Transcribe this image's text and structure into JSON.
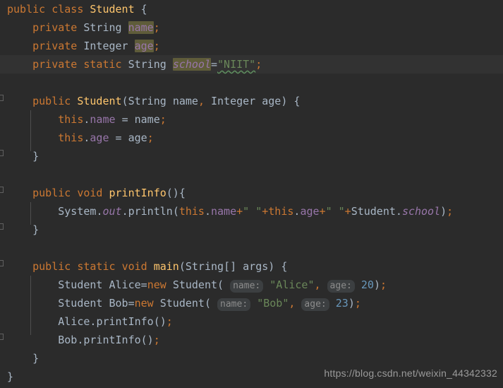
{
  "editor": {
    "language": "java",
    "theme": "darcula",
    "background_color": "#2b2b2b",
    "current_line_color": "#323232",
    "default_text_color": "#a9b7c6",
    "current_line_number": 4,
    "colors": {
      "keyword": "#cc7832",
      "string": "#6a8759",
      "number": "#6897bb",
      "field": "#9876aa",
      "class_declaration": "#ffc66d",
      "usage_highlight": "#5f5c3a",
      "inlay_hint_bg": "#3c3f41",
      "inlay_hint_text": "#8c8c8c",
      "typo_underline": "#5f8f5f",
      "indent_guide": "#4e4e4e",
      "fold_marker": "#606060"
    }
  },
  "code": {
    "lines": [
      {
        "n": 1,
        "text": "public class Student {"
      },
      {
        "n": 2,
        "text": "    private String name;"
      },
      {
        "n": 3,
        "text": "    private Integer age;"
      },
      {
        "n": 4,
        "text": "    private static String school=\"NIIT\";"
      },
      {
        "n": 5,
        "text": ""
      },
      {
        "n": 6,
        "text": "    public Student(String name, Integer age) {"
      },
      {
        "n": 7,
        "text": "        this.name = name;"
      },
      {
        "n": 8,
        "text": "        this.age = age;"
      },
      {
        "n": 9,
        "text": "    }"
      },
      {
        "n": 10,
        "text": ""
      },
      {
        "n": 11,
        "text": "    public void printInfo(){"
      },
      {
        "n": 12,
        "text": "        System.out.println(this.name+\" \"+this.age+\" \"+Student.school);"
      },
      {
        "n": 13,
        "text": "    }"
      },
      {
        "n": 14,
        "text": ""
      },
      {
        "n": 15,
        "text": "    public static void main(String[] args) {"
      },
      {
        "n": 16,
        "text": "        Student Alice=new Student( name: \"Alice\", age: 20);"
      },
      {
        "n": 17,
        "text": "        Student Bob=new Student( name: \"Bob\", age: 23);"
      },
      {
        "n": 18,
        "text": "        Alice.printInfo();"
      },
      {
        "n": 19,
        "text": "        Bob.printInfo();"
      },
      {
        "n": 20,
        "text": "    }"
      },
      {
        "n": 21,
        "text": "}"
      }
    ],
    "tokens": {
      "kw_public": "public",
      "kw_class": "class",
      "kw_private": "private",
      "kw_static": "static",
      "kw_void": "void",
      "kw_new": "new",
      "kw_this": "this",
      "type_string": "String",
      "type_integer": "Integer",
      "class_student": "Student",
      "field_name": "name",
      "field_age": "age",
      "field_school": "school",
      "method_printinfo": "printInfo",
      "method_main": "main",
      "method_println": "println",
      "obj_system": "System",
      "field_out": "out",
      "var_alice": "Alice",
      "var_bob": "Bob",
      "param_args": "args",
      "str_niit": "\"NIIT\"",
      "str_alice": "\"Alice\"",
      "str_bob": "\"Bob\"",
      "str_space": "\" \"",
      "num_20": "20",
      "num_23": "23"
    },
    "inlay_hints": [
      {
        "label": "name:",
        "line": 16
      },
      {
        "label": "age:",
        "line": 16
      },
      {
        "label": "name:",
        "line": 17
      },
      {
        "label": "age:",
        "line": 17
      }
    ],
    "typos": [
      {
        "text": "NIIT",
        "line": 4
      }
    ],
    "usage_highlights": [
      {
        "text": "name",
        "line": 2
      },
      {
        "text": "age",
        "line": 3
      },
      {
        "text": "school",
        "line": 4
      }
    ]
  },
  "watermark": {
    "text": "https://blog.csdn.net/weixin_44342332"
  }
}
